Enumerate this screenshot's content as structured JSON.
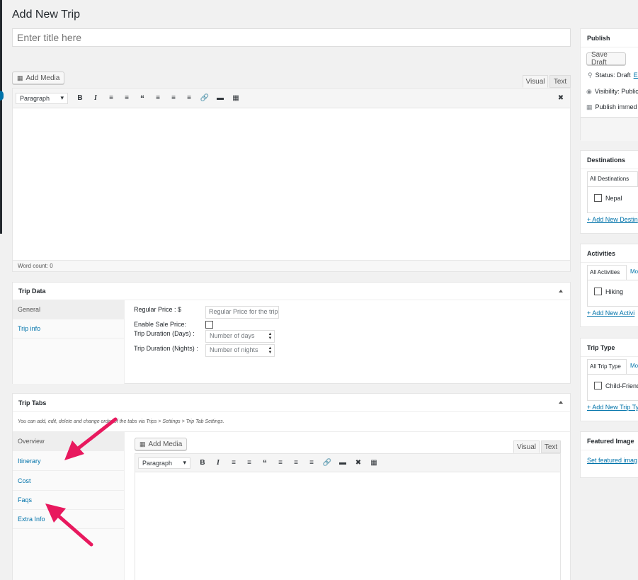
{
  "page": {
    "title": "Add New Trip"
  },
  "title_input": {
    "placeholder": "Enter title here"
  },
  "editor": {
    "add_media": "Add Media",
    "tab_visual": "Visual",
    "tab_text": "Text",
    "format": "Paragraph",
    "word_count": "Word count: 0"
  },
  "trip_data": {
    "title": "Trip Data",
    "tabs": [
      "General",
      "Trip info"
    ],
    "regular_price_label": "Regular Price : $",
    "regular_price_placeholder": "Regular Price for the trip",
    "sale_label": "Enable Sale Price:",
    "days_label": "Trip Duration (Days) :",
    "days_placeholder": "Number of days",
    "nights_label": "Trip Duration (Nights) :",
    "nights_placeholder": "Number of nights"
  },
  "trip_tabs": {
    "title": "Trip Tabs",
    "note": "You can add, edit, delete and change order of the tabs via Trips > Settings > Trip Tab Settings.",
    "tabs": [
      "Overview",
      "Itinerary",
      "Cost",
      "Faqs",
      "Extra Info"
    ],
    "add_media": "Add Media",
    "tab_visual": "Visual",
    "tab_text": "Text",
    "format": "Paragraph"
  },
  "publish": {
    "title": "Publish",
    "save_draft": "Save Draft",
    "status": "Status: Draft",
    "status_edit": "Ed",
    "visibility": "Visibility: Public",
    "schedule": "Publish immed"
  },
  "destinations": {
    "title": "Destinations",
    "tab_all": "All Destinations",
    "items": [
      "Nepal"
    ],
    "add_link": "+ Add New Destin"
  },
  "activities": {
    "title": "Activities",
    "tab_all": "All Activities",
    "tab_most": "Mo",
    "items": [
      "Hiking"
    ],
    "add_link": "+ Add New Activi"
  },
  "trip_type": {
    "title": "Trip Type",
    "tab_all": "All Trip Type",
    "tab_most": "Mo",
    "items": [
      "Child-Friend"
    ],
    "add_link": "+ Add New Trip Ty"
  },
  "featured_image": {
    "title": "Featured Image",
    "link": "Set featured imag"
  },
  "colors": {
    "accent": "#0073aa",
    "annotation": "#e8195e"
  }
}
